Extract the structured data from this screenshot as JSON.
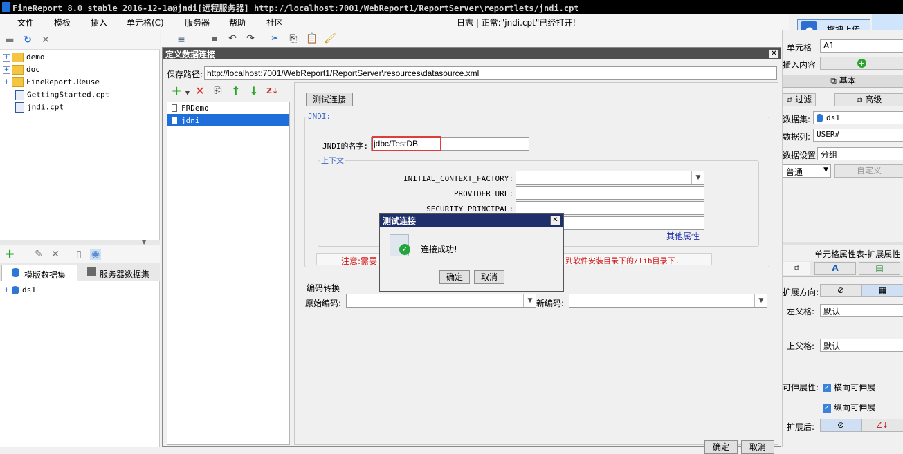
{
  "window": {
    "title": "FineReport 8.0 stable 2016-12-1a@jndi[远程服务器]    http://localhost:7001/WebReport1/ReportServer\\reportlets/jndi.cpt"
  },
  "menu": [
    "文件",
    "模板",
    "插入",
    "单元格(C)",
    "服务器",
    "帮助",
    "社区"
  ],
  "status": "日志 | 正常:\"jndi.cpt\"已经打开!",
  "upload_button": "拖拽上传",
  "tree": [
    {
      "label": "demo",
      "type": "folder"
    },
    {
      "label": "doc",
      "type": "folder"
    },
    {
      "label": "FineReport.Reuse",
      "type": "folder"
    },
    {
      "label": "GettingStarted.cpt",
      "type": "file"
    },
    {
      "label": "jndi.cpt",
      "type": "file"
    }
  ],
  "dataset_tabs": [
    "模版数据集",
    "服务器数据集"
  ],
  "datasets": [
    "ds1"
  ],
  "dialog": {
    "title": "定义数据连接",
    "save_path_label": "保存路径:",
    "save_path": "http://localhost:7001/WebReport1/ReportServer\\resources\\datasource.xml",
    "connections": [
      "FRDemo",
      "jdni"
    ],
    "test_button": "测试连接",
    "jndi_group": "JNDI:",
    "jndi_name_label": "JNDI的名字:",
    "jndi_name": "jdbc/TestDB",
    "context_group": "上下文",
    "ctx_labels": [
      "INITIAL_CONTEXT_FACTORY:",
      "PROVIDER_URL:",
      "SECURITY_PRINCIPAL:"
    ],
    "other_props": "其他属性",
    "note_left": "注意:需要",
    "note_right": "到软件安装目录下的/lib目录下.",
    "encoding_group": "编码转换",
    "orig_encoding_label": "原始编码:",
    "new_encoding_label": "新编码:",
    "ok": "确定",
    "cancel": "取消"
  },
  "popup": {
    "title": "测试连接",
    "message": "连接成功!",
    "ok": "确定",
    "cancel": "取消"
  },
  "right": {
    "cell_label": "单元格",
    "cell_value": "A1",
    "insert_label": "插入内容",
    "basic": "基本",
    "filter": "过滤",
    "advanced": "高级",
    "dataset_label": "数据集:",
    "dataset_value": "ds1",
    "column_label": "数据列:",
    "column_value": "USER#",
    "setting_label": "数据设置",
    "setting_value": "分组",
    "mode_value": "普通",
    "custom": "自定义",
    "props_title": "单元格属性表-扩展属性",
    "expand_dir_label": "扩展方向:",
    "left_parent_label": "左父格:",
    "left_parent_value": "默认",
    "top_parent_label": "上父格:",
    "top_parent_value": "默认",
    "stretch_label": "可伸展性:",
    "stretch_h": "横向可伸展",
    "stretch_v": "纵向可伸展",
    "after_label": "扩展后:"
  },
  "colors": {
    "accent": "#3866c6",
    "selection": "#1e6fd9",
    "popup_title": "#1f2f6b",
    "highlight_border": "#e03c3c",
    "success": "#22a53a",
    "add": "#2aa52a",
    "delete": "#e02020"
  }
}
